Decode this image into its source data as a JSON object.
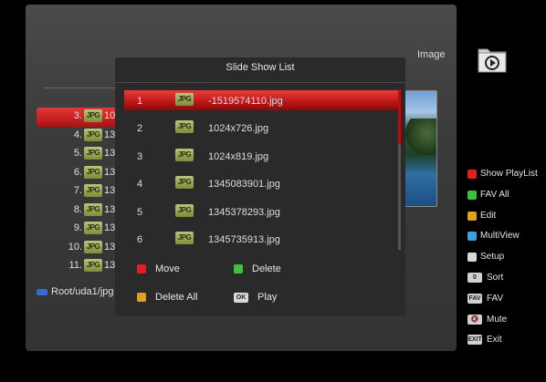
{
  "header": {
    "section_label": "Image",
    "folder_icon": "folder-play-icon"
  },
  "file_list": {
    "rows": [
      {
        "num": "3.",
        "name": "10",
        "selected": true
      },
      {
        "num": "4.",
        "name": "13"
      },
      {
        "num": "5.",
        "name": "13"
      },
      {
        "num": "6.",
        "name": "13"
      },
      {
        "num": "7.",
        "name": "13"
      },
      {
        "num": "8.",
        "name": "13"
      },
      {
        "num": "9.",
        "name": "13"
      },
      {
        "num": "10.",
        "name": "13"
      },
      {
        "num": "11.",
        "name": "13"
      }
    ],
    "tag": "JPG",
    "path": "Root/uda1/jpg"
  },
  "dialog": {
    "title": "Slide Show List",
    "tag": "JPG",
    "items": [
      {
        "idx": "1",
        "name": "-1519574110.jpg",
        "selected": true
      },
      {
        "idx": "2",
        "name": "1024x726.jpg"
      },
      {
        "idx": "3",
        "name": "1024x819.jpg"
      },
      {
        "idx": "4",
        "name": "1345083901.jpg"
      },
      {
        "idx": "5",
        "name": "1345378293.jpg"
      },
      {
        "idx": "6",
        "name": "1345735913.jpg"
      }
    ],
    "actions": {
      "move": "Move",
      "delete": "Delete",
      "delete_all": "Delete All",
      "ok_key": "OK",
      "play": "Play"
    }
  },
  "legend": {
    "items": [
      {
        "label": "Show PlayList",
        "color": "#e02020"
      },
      {
        "label": "FAV All",
        "color": "#40c040"
      },
      {
        "label": "Edit",
        "color": "#e0a020"
      },
      {
        "label": "MultiView",
        "color": "#3aa0e0"
      },
      {
        "label": "Setup",
        "color": "#d8d8d8"
      }
    ],
    "keys": [
      {
        "key": "0",
        "label": "Sort"
      },
      {
        "key": "FAV",
        "label": "FAV"
      },
      {
        "key": "🔇",
        "label": "Mute"
      },
      {
        "key": "EXIT",
        "label": "Exit"
      }
    ]
  },
  "colors": {
    "accent": "#c61a1a",
    "move": "#e02020",
    "delete": "#40c040",
    "delete_all": "#e0a020"
  }
}
